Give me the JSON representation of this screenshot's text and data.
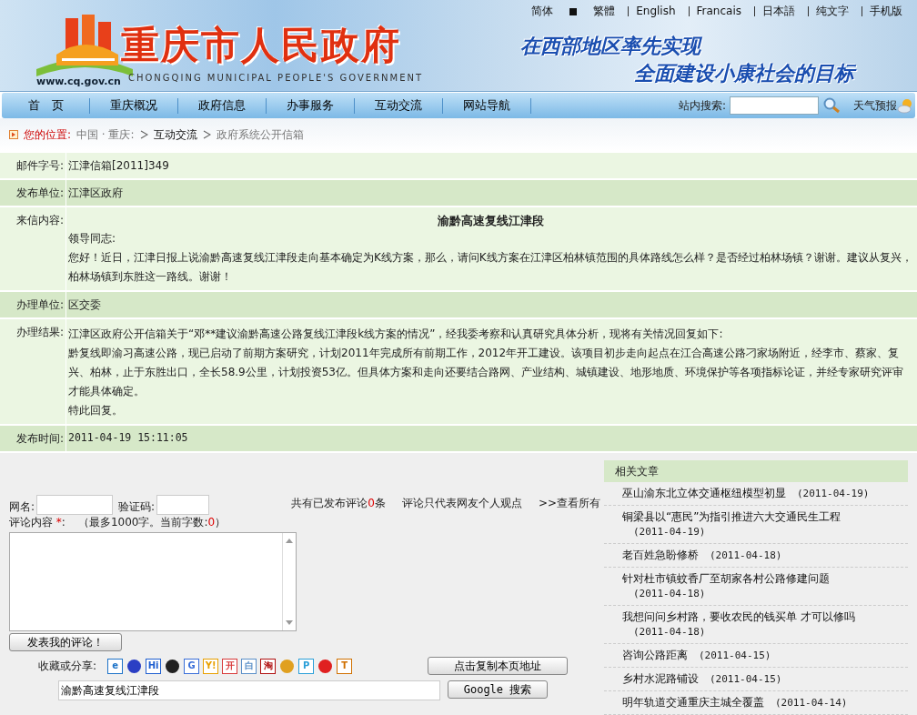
{
  "top_links": [
    {
      "label": "简体",
      "marker": true
    },
    {
      "label": "繁體",
      "marker": false
    },
    {
      "label": "English",
      "marker": false
    },
    {
      "label": "Francais",
      "marker": false
    },
    {
      "label": "日本語",
      "marker": false
    },
    {
      "label": "纯文字",
      "marker": false
    },
    {
      "label": "手机版",
      "marker": false
    }
  ],
  "banner": {
    "title": "重庆市人民政府",
    "subtitle": "CHONGQING MUNICIPAL PEOPLE'S GOVERNMENT",
    "url": "www.cq.gov.cn",
    "slogan": [
      "在西部地区率先实现",
      "全面建设小康社会的目标"
    ]
  },
  "nav": {
    "items": [
      "首　页",
      "重庆概况",
      "政府信息",
      "办事服务",
      "互动交流",
      "网站导航"
    ],
    "search_label": "站内搜索:",
    "weather": "天气预报"
  },
  "breadcrumb": {
    "label": "您的位置:",
    "items": [
      {
        "text": "中国 · 重庆:",
        "current": false
      },
      {
        "text": "互动交流",
        "current": true
      },
      {
        "text": "政府系统公开信箱",
        "current": false
      }
    ]
  },
  "details": [
    {
      "kind": "text",
      "label": "邮件字号:",
      "value": "江津信箱[2011]349"
    },
    {
      "kind": "text",
      "label": "发布单位:",
      "value": "江津区政府"
    },
    {
      "kind": "letter",
      "label": "来信内容:",
      "title": "渝黔高速复线江津段",
      "paragraphs": [
        "领导同志:",
        "您好！近日，江津日报上说渝黔高速复线江津段走向基本确定为K线方案，那么，请问K线方案在江津区柏林镇范围的具体路线怎么样？是否经过柏林场镇？谢谢。建议从复兴，柏林场镇到东胜这一路线。谢谢！"
      ]
    },
    {
      "kind": "text",
      "label": "办理单位:",
      "value": "区交委"
    },
    {
      "kind": "letter",
      "label": "办理结果:",
      "paragraphs": [
        "江津区政府公开信箱关于“邓**建议渝黔高速公路复线江津段k线方案的情况”，经我委考察和认真研究具体分析，现将有关情况回复如下:",
        "黔复线即渝习高速公路，现已启动了前期方案研究，计划2011年完成所有前期工作，2012年开工建设。该项目初步走向起点在江合高速公路刁家场附近，经李市、蔡家、复兴、柏林，止于东胜出口，全长58.9公里，计划投资53亿。但具体方案和走向还要结合路网、产业结构、城镇建设、地形地质、环境保护等各项指标论证，并经专家研究评审才能具体确定。",
        "特此回复。"
      ]
    },
    {
      "kind": "mono",
      "label": "发布时间:",
      "value": "2011-04-19 15:11:05"
    }
  ],
  "comments": {
    "name_label": "网名:",
    "code_label": "验证码:",
    "count_prefix": "共有已发布评论",
    "count": "0",
    "count_suffix": "条",
    "disclaimer": "评论只代表网友个人观点",
    "view_all": ">>查看所有",
    "content_label": "评论内容",
    "required": "*",
    "content_colon": ":",
    "limit_prefix": "（最多1000字。当前字数:",
    "limit_count": "0",
    "limit_suffix": "）",
    "submit": "发表我的评论！",
    "share_label": "收藏或分享:",
    "copy_button": "点击复制本页地址",
    "search_value": "渝黔高速复线江津段",
    "search_button": "Google 搜索"
  },
  "share_icons": [
    {
      "kind": "letter",
      "glyph": "e",
      "color": "#1e73c8"
    },
    {
      "kind": "dot",
      "color": "#2b3fc4"
    },
    {
      "kind": "letter",
      "glyph": "Hi",
      "color": "#1f5fd0"
    },
    {
      "kind": "dot",
      "color": "#222222"
    },
    {
      "kind": "letter",
      "glyph": "G",
      "color": "#3a6fd8"
    },
    {
      "kind": "letter",
      "glyph": "Y!",
      "color": "#e8a000"
    },
    {
      "kind": "letter",
      "glyph": "开",
      "color": "#d83a3a"
    },
    {
      "kind": "letter",
      "glyph": "白",
      "color": "#5b8fc8"
    },
    {
      "kind": "letter",
      "glyph": "淘",
      "color": "#b01010"
    },
    {
      "kind": "dot",
      "color": "#e0a020"
    },
    {
      "kind": "letter",
      "glyph": "P",
      "color": "#2a9fd8"
    },
    {
      "kind": "dot",
      "color": "#e02020"
    },
    {
      "kind": "letter",
      "glyph": "T",
      "color": "#d07000"
    }
  ],
  "related": {
    "title": "相关文章",
    "items": [
      {
        "title": "巫山渝东北立体交通枢纽模型初显",
        "date": "(2011-04-19)"
      },
      {
        "title": "铜梁县以“惠民”为指引推进六大交通民生工程",
        "date": "(2011-04-19)"
      },
      {
        "title": "老百姓急盼修桥",
        "date": "(2011-04-18)"
      },
      {
        "title": "针对杜市镇蚊香厂至胡家各村公路修建问题",
        "date": "(2011-04-18)"
      },
      {
        "title": "我想问问乡村路，要收农民的钱买单 才可以修吗",
        "date": "(2011-04-18)"
      },
      {
        "title": "咨询公路距离",
        "date": "(2011-04-15)"
      },
      {
        "title": "乡村水泥路铺设",
        "date": "(2011-04-15)"
      },
      {
        "title": "明年轨道交通重庆主城全覆盖",
        "date": "(2011-04-14)"
      }
    ]
  }
}
